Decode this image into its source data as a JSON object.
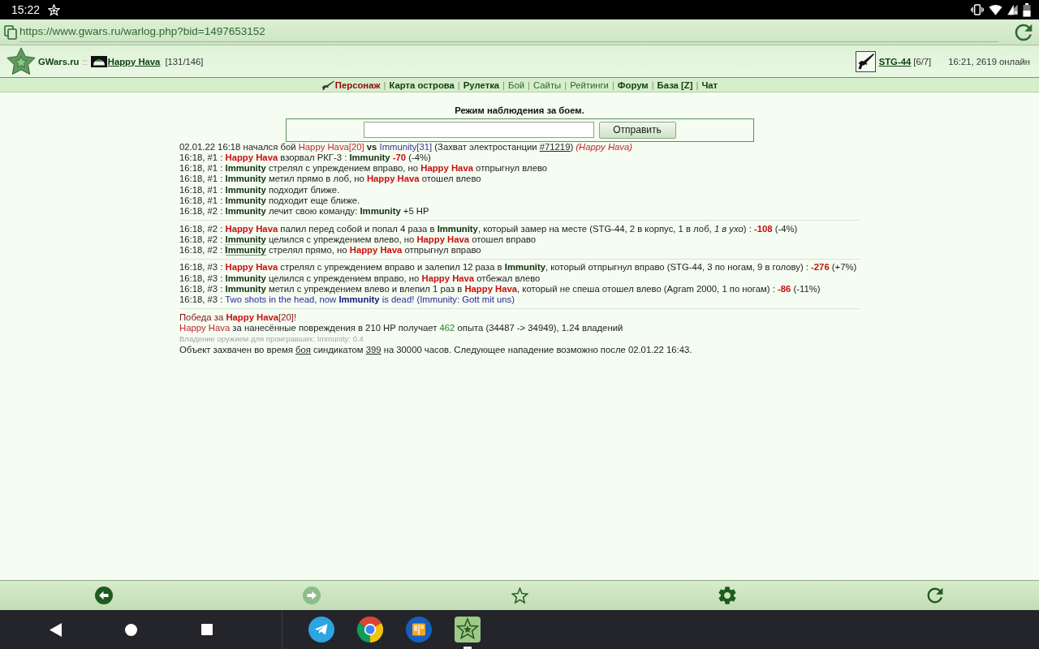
{
  "status_bar": {
    "time": "15:22"
  },
  "address_bar": {
    "url": "https://www.gwars.ru/warlog.php?bid=1497653152"
  },
  "header": {
    "site_name": "GWars.ru",
    "separator": "::",
    "player": {
      "name": "Happy Hava",
      "hp": "[131/146]"
    },
    "weapon": {
      "name": "STG-44",
      "ammo": "[6/7]"
    },
    "server_status": "16:21, 2619 онлайн"
  },
  "nav": {
    "separator": "|",
    "items": [
      {
        "label": "Персонаж",
        "kind": "accent"
      },
      {
        "label": "Карта острова",
        "kind": "bold"
      },
      {
        "label": "Рулетка",
        "kind": "bold"
      },
      {
        "label": "Бой",
        "kind": "plain"
      },
      {
        "label": "Сайты",
        "kind": "plain"
      },
      {
        "label": "Рейтинги",
        "kind": "plain"
      },
      {
        "label": "Форум",
        "kind": "bold"
      },
      {
        "label": "База [Z]",
        "kind": "bold"
      },
      {
        "label": "Чат",
        "kind": "bold"
      }
    ]
  },
  "watch_form": {
    "title": "Режим наблюдения за боем.",
    "button": "Отправить"
  },
  "battle_log": {
    "groups": [
      {
        "lines": [
          {
            "parts": [
              {
                "text": "02.01.22 16:18 начался бой ",
                "kind": "plain"
              },
              {
                "text": "Happy Hava[20]",
                "kind": "team1plain"
              },
              {
                "text": " vs ",
                "kind": "strong"
              },
              {
                "text": "Immunity[31]",
                "kind": "team2plain"
              },
              {
                "text": " (Захват электростанции ",
                "kind": "plain"
              },
              {
                "text": "#71219",
                "kind": "link"
              },
              {
                "text": ") ",
                "kind": "plain"
              },
              {
                "text": "(Happy Hava)",
                "kind": "team1italic"
              }
            ]
          },
          {
            "parts": [
              {
                "text": "16:18, #1 : ",
                "kind": "plain"
              },
              {
                "text": "Happy Hava",
                "kind": "team1"
              },
              {
                "text": " взорвал РКГ-3 : ",
                "kind": "plain"
              },
              {
                "text": "Immunity",
                "kind": "team2"
              },
              {
                "text": " -70",
                "kind": "damage"
              },
              {
                "text": " (-4%)",
                "kind": "plain"
              }
            ]
          },
          {
            "parts": [
              {
                "text": "16:18, #1 : ",
                "kind": "plain"
              },
              {
                "text": "Immunity",
                "kind": "team2"
              },
              {
                "text": " стрелял с упреждением вправо, но ",
                "kind": "plain"
              },
              {
                "text": "Happy Hava",
                "kind": "team1"
              },
              {
                "text": " отпрыгнул влево",
                "kind": "plain"
              }
            ]
          },
          {
            "parts": [
              {
                "text": "16:18, #1 : ",
                "kind": "plain"
              },
              {
                "text": "Immunity",
                "kind": "team2"
              },
              {
                "text": " метил прямо в лоб, но ",
                "kind": "plain"
              },
              {
                "text": "Happy Hava",
                "kind": "team1"
              },
              {
                "text": " отошел влево",
                "kind": "plain"
              }
            ]
          },
          {
            "parts": [
              {
                "text": "16:18, #1 : ",
                "kind": "plain"
              },
              {
                "text": "Immunity",
                "kind": "team2"
              },
              {
                "text": " подходит ближе.",
                "kind": "plain"
              }
            ]
          },
          {
            "parts": [
              {
                "text": "16:18, #1 : ",
                "kind": "plain"
              },
              {
                "text": "Immunity",
                "kind": "team2"
              },
              {
                "text": " подходит еще ближе.",
                "kind": "plain"
              }
            ]
          },
          {
            "parts": [
              {
                "text": "16:18, #2 : ",
                "kind": "plain"
              },
              {
                "text": "Immunity",
                "kind": "team2"
              },
              {
                "text": " лечит свою команду: ",
                "kind": "plain"
              },
              {
                "text": "Immunity",
                "kind": "team2"
              },
              {
                "text": " +5 HP",
                "kind": "plain"
              }
            ]
          }
        ]
      },
      {
        "lines": [
          {
            "parts": [
              {
                "text": "16:18, #2 : ",
                "kind": "plain"
              },
              {
                "text": "Happy Hava",
                "kind": "team1"
              },
              {
                "text": " палил перед собой и попал 4 раза в ",
                "kind": "plain"
              },
              {
                "text": "Immunity",
                "kind": "team2"
              },
              {
                "text": ", который замер на месте (STG-44, 2 в корпус, 1 в лоб, ",
                "kind": "plain"
              },
              {
                "text": "1 в ухо",
                "kind": "italic"
              },
              {
                "text": ") : ",
                "kind": "plain"
              },
              {
                "text": "-108",
                "kind": "damage"
              },
              {
                "text": " (-4%)",
                "kind": "plain"
              }
            ]
          },
          {
            "parts": [
              {
                "text": "16:18, #2 : ",
                "kind": "plain"
              },
              {
                "text": "Immunity",
                "kind": "team2"
              },
              {
                "text": " целился с упреждением влево, но ",
                "kind": "plain"
              },
              {
                "text": "Happy Hava",
                "kind": "team1"
              },
              {
                "text": " отошел вправо",
                "kind": "plain"
              }
            ]
          },
          {
            "parts": [
              {
                "text": "16:18, #2 : ",
                "kind": "plain"
              },
              {
                "text": "Immunity",
                "kind": "focused"
              },
              {
                "text": " стрелял прямо, но ",
                "kind": "plain"
              },
              {
                "text": "Happy Hava",
                "kind": "team1"
              },
              {
                "text": " отпрыгнул вправо",
                "kind": "plain"
              }
            ]
          }
        ]
      },
      {
        "lines": [
          {
            "parts": [
              {
                "text": "16:18, #3 : ",
                "kind": "plain"
              },
              {
                "text": "Happy Hava",
                "kind": "team1"
              },
              {
                "text": " стрелял с упреждением вправо и залепил 12 раза в ",
                "kind": "plain"
              },
              {
                "text": "Immunity",
                "kind": "team2"
              },
              {
                "text": ", который отпрыгнул вправо (STG-44, 3 по ногам, 9 в голову) : ",
                "kind": "plain"
              },
              {
                "text": "-276",
                "kind": "damage"
              },
              {
                "text": " (+7%)",
                "kind": "plain"
              }
            ]
          },
          {
            "parts": [
              {
                "text": "16:18, #3 : ",
                "kind": "plain"
              },
              {
                "text": "Immunity",
                "kind": "team2"
              },
              {
                "text": " целился с упреждением вправо, но ",
                "kind": "plain"
              },
              {
                "text": "Happy Hava",
                "kind": "team1"
              },
              {
                "text": " отбежал влево",
                "kind": "plain"
              }
            ]
          },
          {
            "parts": [
              {
                "text": "16:18, #3 : ",
                "kind": "plain"
              },
              {
                "text": "Immunity",
                "kind": "team2"
              },
              {
                "text": " метил с упреждением влево и влепил 1 раз в ",
                "kind": "plain"
              },
              {
                "text": "Happy Hava",
                "kind": "team1"
              },
              {
                "text": ", который не спеша отошел влево (Agram 2000, 1 по ногам) : ",
                "kind": "plain"
              },
              {
                "text": "-86",
                "kind": "damage"
              },
              {
                "text": " (-11%)",
                "kind": "plain"
              }
            ]
          },
          {
            "parts": [
              {
                "text": "16:18, #3 : ",
                "kind": "plain"
              },
              {
                "text": "Two shots in the head, now ",
                "kind": "message"
              },
              {
                "text": "Immunity",
                "kind": "messagebold"
              },
              {
                "text": " is dead! (Immunity: Gott mit uns)",
                "kind": "message"
              }
            ]
          }
        ]
      },
      {
        "lines": [
          {
            "parts": [
              {
                "text": "Победа за ",
                "kind": "victory"
              },
              {
                "text": "Happy Hava",
                "kind": "team1"
              },
              {
                "text": "[20]!",
                "kind": "victory"
              }
            ]
          },
          {
            "parts": [
              {
                "text": "Happy Hava",
                "kind": "team1plain"
              },
              {
                "text": " за нанесённые повреждения в 210 HP получает ",
                "kind": "plain"
              },
              {
                "text": "462",
                "kind": "exp"
              },
              {
                "text": " опыта (34487 -> 34949), 1.24 владений",
                "kind": "plain"
              }
            ]
          },
          {
            "parts": [
              {
                "text": "Владение оружием для проигравших: Immunity: 0.4",
                "kind": "faint"
              }
            ]
          },
          {
            "parts": [
              {
                "text": "Объект захвачен во время ",
                "kind": "plain"
              },
              {
                "text": "боя",
                "kind": "link"
              },
              {
                "text": " синдикатом ",
                "kind": "plain"
              },
              {
                "text": "399",
                "kind": "link"
              },
              {
                "text": " на 30000 часов. Следующее нападение возможно после 02.01.22 16:43.",
                "kind": "plain"
              }
            ]
          }
        ]
      }
    ]
  },
  "toolbar": [
    {
      "kind": "back",
      "disabled": false
    },
    {
      "kind": "forward",
      "disabled": true
    },
    {
      "kind": "bookmark",
      "disabled": false
    },
    {
      "kind": "settings",
      "disabled": false
    },
    {
      "kind": "reload",
      "disabled": false
    }
  ],
  "dock": [
    {
      "kind": "messenger",
      "selected": false
    },
    {
      "kind": "browser",
      "selected": false
    },
    {
      "kind": "reader",
      "selected": false
    },
    {
      "kind": "game",
      "selected": true
    }
  ]
}
